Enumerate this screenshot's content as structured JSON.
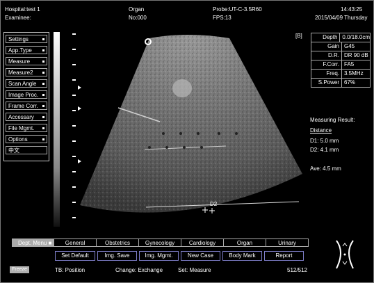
{
  "header": {
    "hospital": "Hospital:test 1",
    "examinee": "Examinee:",
    "organ": "Organ",
    "number": "No:000",
    "probe": "Probe:UT-C-3.5R60",
    "fps": "FPS:13",
    "time": "14:43:25",
    "date": "2015/04/09 Thursday"
  },
  "left_menu": {
    "items": [
      {
        "label": "Settings"
      },
      {
        "label": "App.Type"
      },
      {
        "label": "Measure"
      },
      {
        "label": "Measure2"
      },
      {
        "label": "Scan Angle"
      },
      {
        "label": "Image Proc."
      },
      {
        "label": "Frame Corr."
      },
      {
        "label": "Accessary"
      },
      {
        "label": "File Mgmt."
      },
      {
        "label": "Options"
      },
      {
        "label": "中文"
      }
    ]
  },
  "mode_label": "[B]",
  "params": {
    "rows": [
      {
        "label": "Depth",
        "value": "0.0/18.0cm"
      },
      {
        "label": "Gain",
        "value": "G45"
      },
      {
        "label": "D.R.",
        "value": "DR 90 dB"
      },
      {
        "label": "F.Corr.",
        "value": "FA5"
      },
      {
        "label": "Freq.",
        "value": "3.5MHz"
      },
      {
        "label": "S.Power",
        "value": "67%"
      }
    ]
  },
  "measurement": {
    "title": "Measuring Result:",
    "type": "Distance",
    "d1": "D1: 5.0 mm",
    "d2": "D2: 4.1 mm",
    "ave": "Ave: 4.5 mm"
  },
  "image_labels": {
    "caliper_label": "D2"
  },
  "categories": {
    "items": [
      {
        "label": "Dept. Menu"
      },
      {
        "label": "General"
      },
      {
        "label": "Obstetrics"
      },
      {
        "label": "Gynecology"
      },
      {
        "label": "Cardiology"
      },
      {
        "label": "Organ"
      },
      {
        "label": "Urinary"
      }
    ]
  },
  "buttons": {
    "items": [
      {
        "label": "Set Default"
      },
      {
        "label": "Img. Save"
      },
      {
        "label": "Img. Mgmt."
      },
      {
        "label": "New Case"
      },
      {
        "label": "Body Mark"
      },
      {
        "label": "Report"
      }
    ]
  },
  "footer": {
    "freeze": "Freeze",
    "tb": "TB: Position",
    "change": "Change: Exchange",
    "set": "Set: Measure",
    "frames": "512/512"
  },
  "colors": {
    "button_border": "#7e7ec8",
    "category_selected": "#aaaaaa"
  }
}
